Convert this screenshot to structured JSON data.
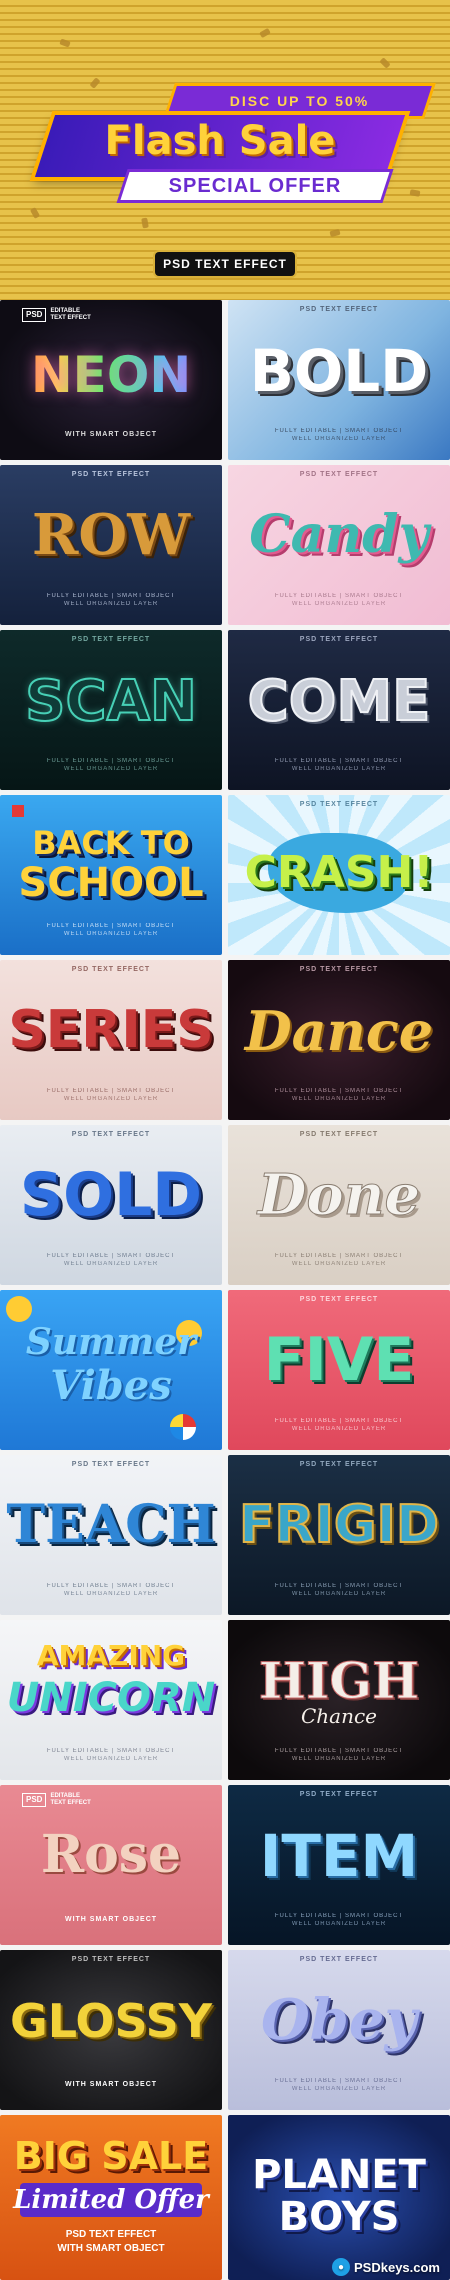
{
  "hero": {
    "discount": "DISC UP TO 50%",
    "title": "Flash Sale",
    "subtitle": "SPECIAL OFFER",
    "badge": "PSD TEXT EFFECT"
  },
  "common": {
    "psd_text_effect": "PSD TEXT EFFECT",
    "fully_editable": "FULLY EDITABLE | SMART OBJECT",
    "well_organized": "WELL ORGANIZED LAYER",
    "with_smart_object": "WITH SMART OBJECT",
    "psd": "PSD",
    "editable": "EDITABLE",
    "text_effect": "TEXT EFFECT"
  },
  "tiles": {
    "neon": "NEON",
    "bold": "BOLD",
    "row": "ROW",
    "candy": "Candy",
    "scan": "SCAN",
    "come": "COME",
    "back_to": "BACK TO",
    "school": "SCHOOL",
    "crash": "CRASH!",
    "series": "SERIES",
    "dance": "Dance",
    "sold": "SOLD",
    "done": "Done",
    "summer": "Summer",
    "vibes": "Vibes",
    "five": "FIVE",
    "teach": "TEACH",
    "frigid": "FRIGID",
    "amazing": "AMAZING",
    "unicorn": "UNICORN",
    "high": "HIGH",
    "chance": "Chance",
    "rose": "Rose",
    "item": "ITEM",
    "glossy": "GLOSSY",
    "obey": "Obey",
    "big_sale": "BIG SALE",
    "limited_offer": "Limited Offer",
    "psd_text_effect_upper": "PSD TEXT EFFECT",
    "with_smart_object_upper": "WITH SMART OBJECT",
    "planet": "PLANET",
    "boys": "BOYS"
  },
  "watermark": {
    "text": "PSDkeys.com"
  },
  "colors": {
    "hero_gold": "#e7c24a",
    "hero_purple": "#7a2bd6",
    "accent_orange": "#ffb000"
  },
  "icons": [
    "psdkeys-logo-icon",
    "smiley-emoji-icon",
    "sunglasses-emoji-icon",
    "beach-ball-icon",
    "red-flag-icon"
  ]
}
